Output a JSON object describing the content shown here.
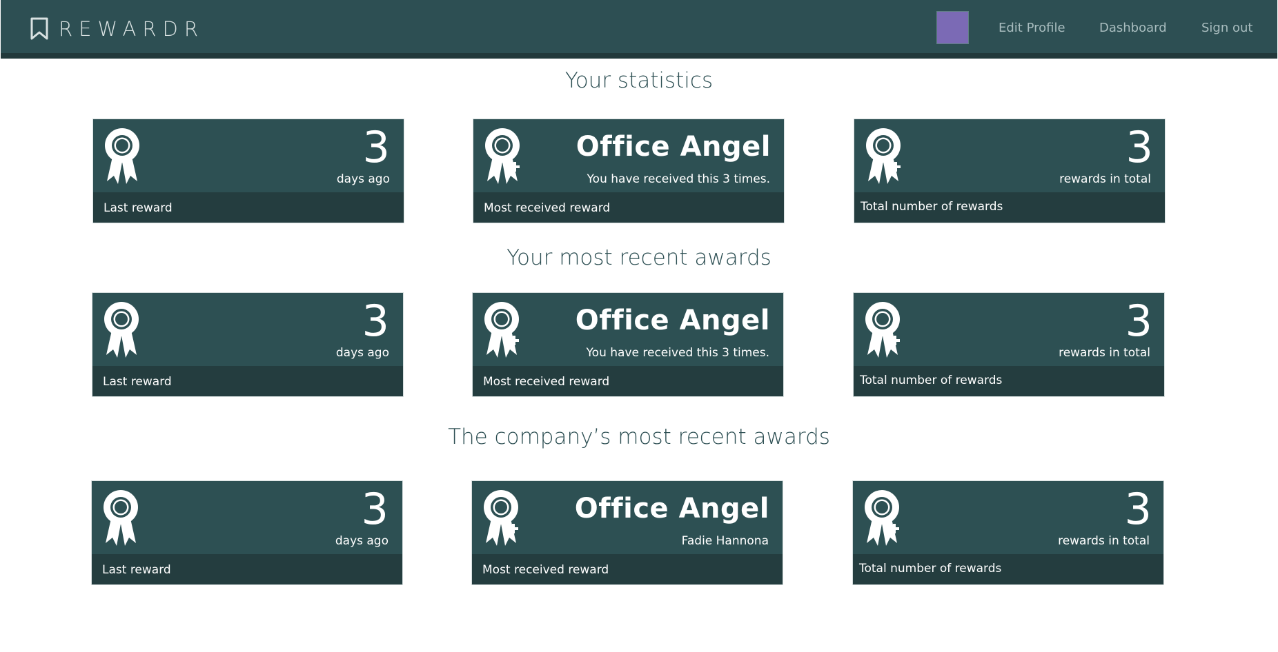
{
  "header": {
    "brand": "REWARDR",
    "nav": {
      "edit_profile": "Edit Profile",
      "dashboard": "Dashboard",
      "sign_out": "Sign out"
    },
    "avatar_color": "#7b6ab5"
  },
  "sections": [
    {
      "title": "Your statistics",
      "cards": [
        {
          "big": "3",
          "sub": "days ago",
          "footer": "Last reward"
        },
        {
          "big": "Office Angel",
          "sub": "You have received this 3 times.",
          "footer": "Most received reward"
        },
        {
          "big": "3",
          "sub": "rewards in total",
          "footer": "Total number of rewards"
        }
      ]
    },
    {
      "title": "Your most recent awards",
      "cards": [
        {
          "big": "3",
          "sub": "days ago",
          "footer": "Last reward"
        },
        {
          "big": "Office Angel",
          "sub": "You have received this 3 times.",
          "footer": "Most received reward"
        },
        {
          "big": "3",
          "sub": "rewards in total",
          "footer": "Total number of rewards"
        }
      ]
    },
    {
      "title": "The company’s most recent awards",
      "cards": [
        {
          "big": "3",
          "sub": "days ago",
          "footer": "Last reward"
        },
        {
          "big": "Office Angel",
          "sub": "Fadie Hannona",
          "footer": "Most received reward"
        },
        {
          "big": "3",
          "sub": "rewards in total",
          "footer": "Total number of rewards"
        }
      ]
    }
  ],
  "colors": {
    "header_bg": "#2d4f53",
    "card_bg": "#2d5053",
    "card_footer_bg": "#243d3f",
    "heading_text": "#2d4f53"
  }
}
